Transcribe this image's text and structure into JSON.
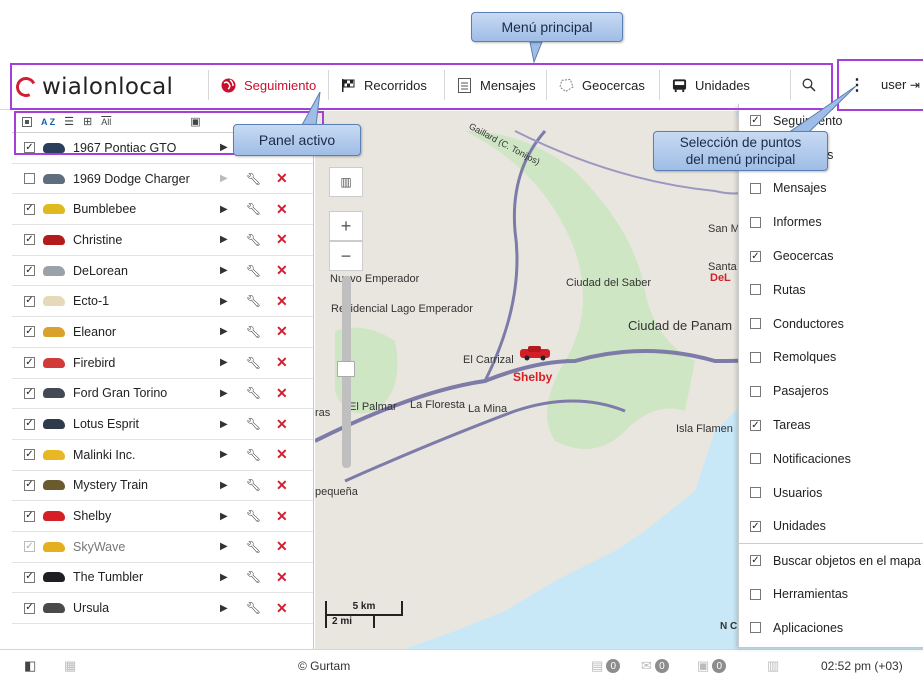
{
  "callouts": {
    "main_menu": "Menú principal",
    "active_panel": "Panel activo",
    "selection_line1": "Selección de puntos",
    "selection_line2": "del menú principal"
  },
  "header": {
    "logo": "wialonlocal",
    "nav": [
      {
        "label": "Seguimiento",
        "icon": "globe-icon",
        "active": true
      },
      {
        "label": "Recorridos",
        "icon": "checkered-flag-icon"
      },
      {
        "label": "Mensajes",
        "icon": "message-list-icon"
      },
      {
        "label": "Geocercas",
        "icon": "geofence-icon"
      },
      {
        "label": "Unidades",
        "icon": "bus-icon"
      }
    ],
    "search_icon": "search-icon",
    "menu_icon": "kebab-menu-icon",
    "user": "user"
  },
  "panel": {
    "toolbar_sort": "A Z",
    "toolbar_all": "All",
    "units": [
      {
        "name": "1967 Pontiac GTO",
        "checked": true,
        "color": "#2b3e5c"
      },
      {
        "name": "1969 Dodge Charger",
        "checked": false,
        "color": "#5e6e7e",
        "dim_actions": true
      },
      {
        "name": "Bumblebee",
        "checked": true,
        "color": "#e0b91e"
      },
      {
        "name": "Christine",
        "checked": true,
        "color": "#b41c1c"
      },
      {
        "name": "DeLorean",
        "checked": true,
        "color": "#9aa1a8"
      },
      {
        "name": "Ecto-1",
        "checked": true,
        "color": "#e6d9b8"
      },
      {
        "name": "Eleanor",
        "checked": true,
        "color": "#d9a22a"
      },
      {
        "name": "Firebird",
        "checked": true,
        "color": "#d23a3a"
      },
      {
        "name": "Ford Gran Torino",
        "checked": true,
        "color": "#444a55"
      },
      {
        "name": "Lotus Esprit",
        "checked": true,
        "color": "#2f3a4a"
      },
      {
        "name": "Malinki Inc.",
        "checked": true,
        "color": "#e8b824"
      },
      {
        "name": "Mystery Train",
        "checked": true,
        "color": "#6b5a2e"
      },
      {
        "name": "Shelby",
        "checked": true,
        "color": "#d41f26"
      },
      {
        "name": "SkyWave",
        "checked": true,
        "color": "#e5b020",
        "dim": true
      },
      {
        "name": "The Tumbler",
        "checked": true,
        "color": "#1d1f22"
      },
      {
        "name": "Ursula",
        "checked": true,
        "color": "#4a4a4a"
      }
    ]
  },
  "map": {
    "labels": [
      "Nuevo Emperador",
      "Residencial Lago Emperador",
      "Ciudad del Saber",
      "Ciudad de Panam",
      "El Carrizal",
      "Shelby",
      "El Palmar",
      "La Floresta",
      "La Mina",
      "Isla Flamen",
      "San M",
      "Santa",
      "DeL",
      "pequeña",
      "ras",
      "N C"
    ],
    "road_label": "Gaillard (C. Tonijos)",
    "scale_km": "5 km",
    "scale_mi": "2 mi"
  },
  "menu_dropdown": {
    "items": [
      {
        "label": "Seguimiento",
        "checked": true
      },
      {
        "label": "Recorridos",
        "checked": true
      },
      {
        "label": "Mensajes",
        "checked": false
      },
      {
        "label": "Informes",
        "checked": false
      },
      {
        "label": "Geocercas",
        "checked": true
      },
      {
        "label": "Rutas",
        "checked": false
      },
      {
        "label": "Conductores",
        "checked": false
      },
      {
        "label": "Remolques",
        "checked": false
      },
      {
        "label": "Pasajeros",
        "checked": false
      },
      {
        "label": "Tareas",
        "checked": true
      },
      {
        "label": "Notificaciones",
        "checked": false
      },
      {
        "label": "Usuarios",
        "checked": false
      },
      {
        "label": "Unidades",
        "checked": true
      },
      {
        "label": "Buscar objetos en el mapa",
        "checked": true
      },
      {
        "label": "Herramientas",
        "checked": false
      },
      {
        "label": "Aplicaciones",
        "checked": false
      }
    ]
  },
  "footer": {
    "copyright": "© Gurtam",
    "count_messages": "0",
    "count_notifications": "0",
    "count_images": "0",
    "time": "02:52 pm (+03)"
  }
}
